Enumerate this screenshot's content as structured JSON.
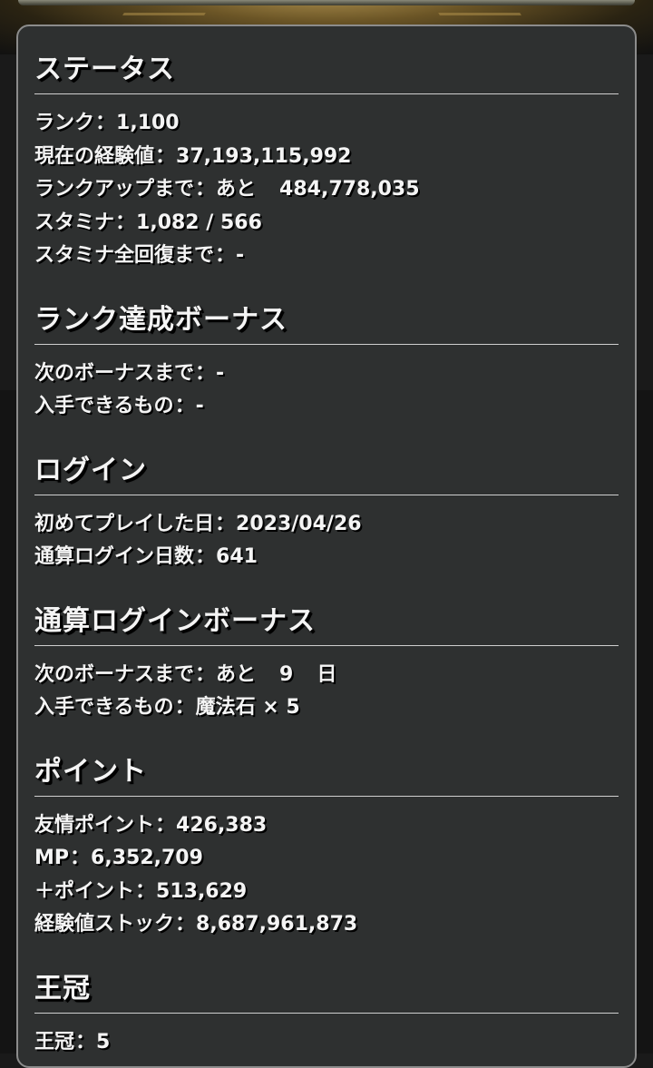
{
  "sections": [
    {
      "title": "ステータス",
      "rows": [
        {
          "label": "ランク",
          "value": "1,100"
        },
        {
          "label": "現在の経験値",
          "value": "37,193,115,992"
        },
        {
          "label": "ランクアップまで",
          "prefix": "あと",
          "value": "484,778,035"
        },
        {
          "label": "スタミナ",
          "value": "1,082 / 566"
        },
        {
          "label": "スタミナ全回復まで",
          "value": "-"
        }
      ]
    },
    {
      "title": "ランク達成ボーナス",
      "rows": [
        {
          "label": "次のボーナスまで",
          "value": "-"
        },
        {
          "label": "入手できるもの",
          "value": "-"
        }
      ]
    },
    {
      "title": "ログイン",
      "rows": [
        {
          "label": "初めてプレイした日",
          "value": "2023/04/26"
        },
        {
          "label": "通算ログイン日数",
          "value": "641"
        }
      ]
    },
    {
      "title": "通算ログインボーナス",
      "rows": [
        {
          "label": "次のボーナスまで",
          "prefix": "あと",
          "value": "9",
          "suffix": "日"
        },
        {
          "label": "入手できるもの",
          "value": "魔法石 × 5"
        }
      ]
    },
    {
      "title": "ポイント",
      "rows": [
        {
          "label": "友情ポイント",
          "value": "426,383"
        },
        {
          "label": "MP",
          "value": "6,352,709"
        },
        {
          "label": "＋ポイント",
          "value": "513,629"
        },
        {
          "label": "経験値ストック",
          "value": "8,687,961,873"
        }
      ]
    },
    {
      "title": "王冠",
      "rows": [
        {
          "label": "王冠",
          "value": "5"
        }
      ]
    }
  ],
  "separator": "："
}
